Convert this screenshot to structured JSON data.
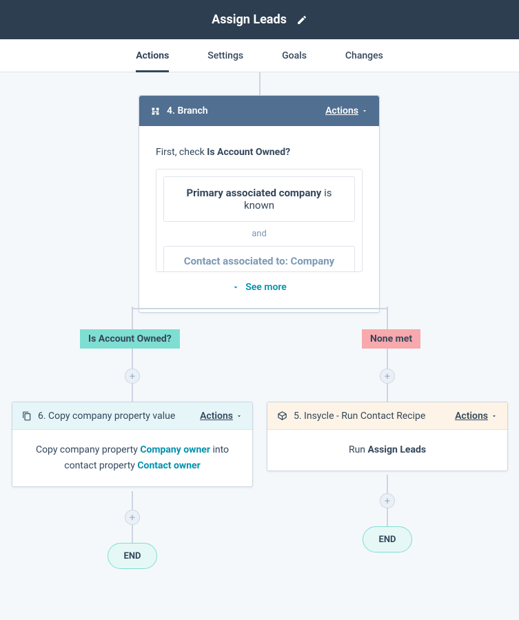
{
  "header": {
    "title": "Assign Leads"
  },
  "tabs": [
    "Actions",
    "Settings",
    "Goals",
    "Changes"
  ],
  "branch": {
    "step_label": "4. Branch",
    "actions_label": "Actions",
    "first_check_prefix": "First, check ",
    "first_check_name": "Is Account Owned?",
    "condition1_bold": "Primary associated company",
    "condition1_rest": " is known",
    "operator": "and",
    "condition2": "Contact associated to: Company",
    "see_more": "See more"
  },
  "branch_labels": {
    "left": "Is Account Owned?",
    "right": "None met"
  },
  "left_card": {
    "title": "6. Copy company property value",
    "actions_label": "Actions",
    "body_prefix": "Copy company property ",
    "body_link1": "Company owner",
    "body_mid": " into contact property ",
    "body_link2": "Contact owner"
  },
  "right_card": {
    "title": "5. Insycle - Run Contact Recipe",
    "actions_label": "Actions",
    "body_prefix": "Run ",
    "body_bold": "Assign Leads"
  },
  "end_label": "END"
}
